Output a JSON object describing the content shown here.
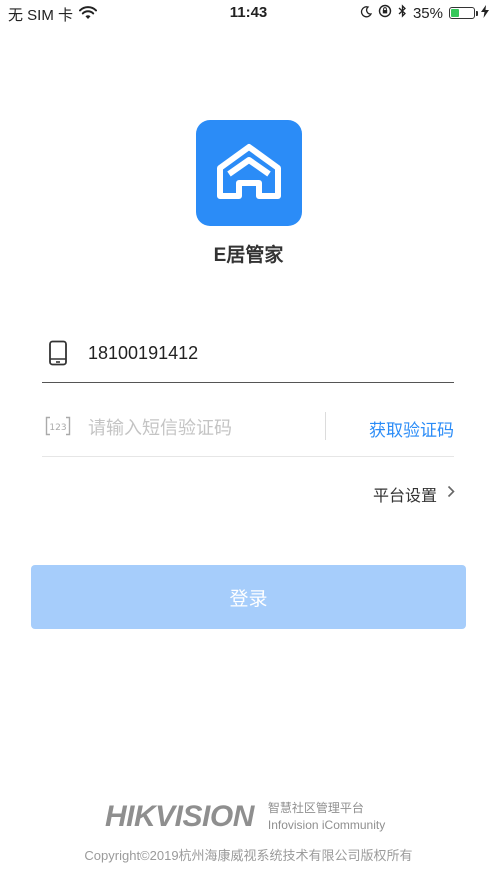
{
  "status_bar": {
    "carrier": "无 SIM 卡",
    "time": "11:43",
    "battery_percent": "35%",
    "battery_level": 0.35
  },
  "app": {
    "name": "E居管家",
    "logo_color": "#2b8cf7"
  },
  "form": {
    "phone_value": "18100191412",
    "code_placeholder": "请输入短信验证码",
    "get_code_label": "获取验证码",
    "platform_settings_label": "平台设置",
    "login_label": "登录"
  },
  "footer": {
    "brand": "HIKVISION",
    "tagline_cn": "智慧社区管理平台",
    "tagline_en": "Infovision iCommunity",
    "copyright": "Copyright©2019杭州海康威视系统技术有限公司版权所有"
  },
  "icons": {
    "phone": "phone-icon",
    "code": "code-123-icon",
    "chevron": "chevron-right-icon"
  },
  "colors": {
    "accent": "#2b8cf7",
    "login_disabled": "#a6cdfb"
  }
}
